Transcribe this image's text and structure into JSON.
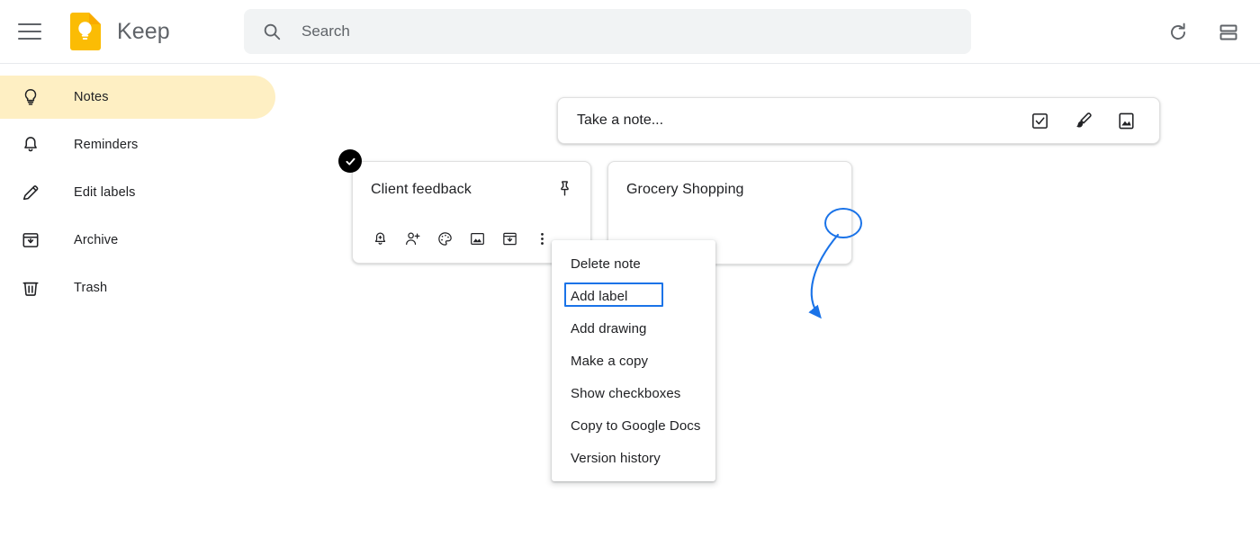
{
  "app": {
    "title": "Keep",
    "logo_color": "#FBBC04",
    "accent_blue": "#1a73e8",
    "active_nav_bg": "#feefc3"
  },
  "header": {
    "menu_icon": "hamburger-icon",
    "logo_icon": "keep-logo-icon",
    "refresh_icon": "refresh-icon",
    "view_toggle_icon": "list-view-icon",
    "search": {
      "icon": "search-icon",
      "placeholder": "Search",
      "value": ""
    }
  },
  "sidebar": {
    "items": [
      {
        "label": "Notes",
        "icon": "lightbulb-icon",
        "active": true
      },
      {
        "label": "Reminders",
        "icon": "bell-icon",
        "active": false
      },
      {
        "label": "Edit labels",
        "icon": "pencil-icon",
        "active": false
      },
      {
        "label": "Archive",
        "icon": "archive-icon",
        "active": false
      },
      {
        "label": "Trash",
        "icon": "trash-icon",
        "active": false
      }
    ]
  },
  "main": {
    "take_note": {
      "placeholder": "Take a note...",
      "actions": [
        {
          "name": "new-list-button",
          "icon": "checkbox-icon"
        },
        {
          "name": "new-drawing-button",
          "icon": "brush-icon"
        },
        {
          "name": "new-image-button",
          "icon": "image-icon"
        }
      ]
    },
    "notes": [
      {
        "title": "Client feedback",
        "selected": true,
        "pinned": false,
        "pin_icon": "pin-icon",
        "toolbar": [
          {
            "name": "remind-me-button",
            "icon": "bell-plus-icon"
          },
          {
            "name": "collaborator-button",
            "icon": "person-plus-icon"
          },
          {
            "name": "background-options-button",
            "icon": "palette-icon"
          },
          {
            "name": "add-image-button",
            "icon": "image-icon"
          },
          {
            "name": "archive-button",
            "icon": "archive-icon"
          },
          {
            "name": "more-options-button",
            "icon": "more-vertical-icon"
          }
        ]
      },
      {
        "title": "Grocery Shopping",
        "selected": false,
        "pinned": false,
        "toolbar": []
      }
    ]
  },
  "context_menu": {
    "items": [
      {
        "label": "Delete note",
        "focused": false
      },
      {
        "label": "Add label",
        "focused": true
      },
      {
        "label": "Add drawing",
        "focused": false
      },
      {
        "label": "Make a copy",
        "focused": false
      },
      {
        "label": "Show checkboxes",
        "focused": false
      },
      {
        "label": "Copy to Google Docs",
        "focused": false
      },
      {
        "label": "Version history",
        "focused": false
      }
    ]
  },
  "annotation": {
    "arrow_color": "#1a73e8",
    "from": "more-options-button",
    "to": "menu-item-add-label"
  }
}
